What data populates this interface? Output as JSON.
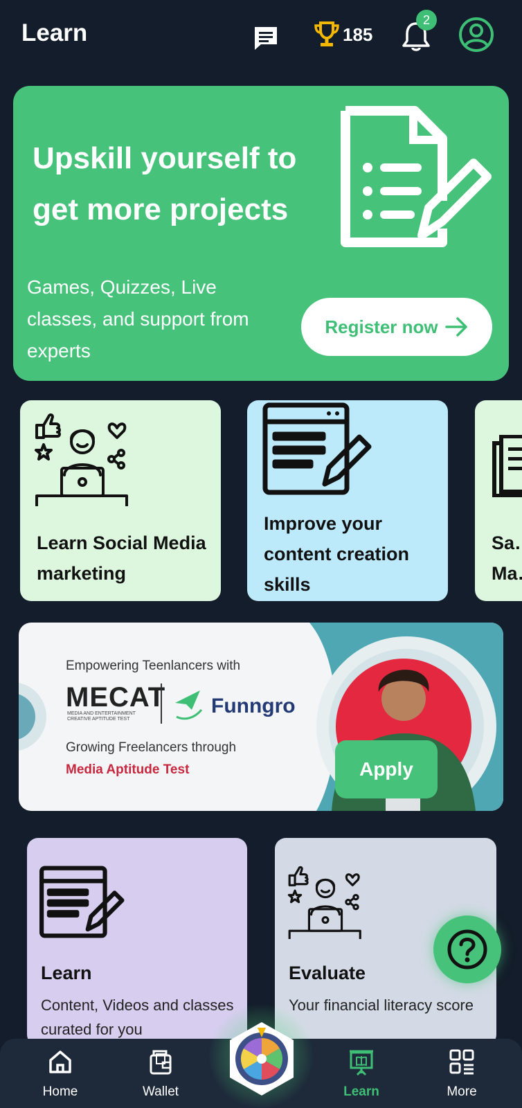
{
  "header": {
    "title": "Learn",
    "icons": [
      "chat-icon",
      "trophy-icon",
      "bell-icon",
      "profile-icon"
    ],
    "trophy_count": "185",
    "notification_count": "2"
  },
  "hero": {
    "headline": "Upskill yourself to get more projects",
    "subtext": "Games, Quizzes, Live classes, and support from experts",
    "register_label": "Register now",
    "background": "#47c27a"
  },
  "skills": {
    "cards": [
      {
        "label": "Learn Social Media marketing",
        "color": "#ddf7de"
      },
      {
        "label": "Improve your content creation skills",
        "color": "#bceafa"
      },
      {
        "label": "Sa… Ma…",
        "color": "#ddf7de"
      }
    ]
  },
  "mecat": {
    "empowering": "Empowering Teenlancers with",
    "logo": "MECAT",
    "logo_sub": "MEDIA AND ENTERTAINMENT CREATIVE APTITUDE TEST",
    "partner": "Funngro",
    "growing": "Growing Freelancers through",
    "test_name": "Media Aptitude Test",
    "apply_label": "Apply"
  },
  "bottom_cards": [
    {
      "title": "Learn",
      "desc": "Content, Videos and classes curated for you",
      "color": "#d7cdef"
    },
    {
      "title": "Evaluate",
      "desc": "Your financial literacy score",
      "color": "#d3dae5"
    }
  ],
  "nav": {
    "home": "Home",
    "wallet": "Wallet",
    "learn": "Learn",
    "more": "More",
    "active": "Learn",
    "accent": "#3fbf76"
  }
}
